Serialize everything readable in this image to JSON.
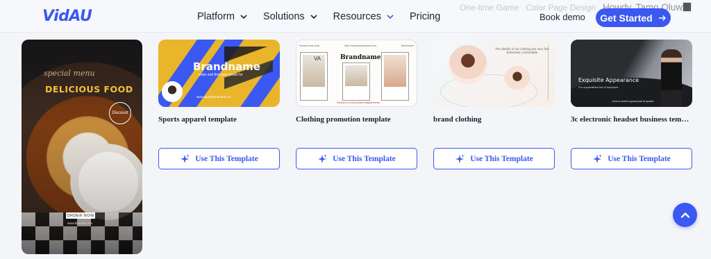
{
  "header": {
    "logo": "VidAU",
    "nav": [
      {
        "label": "Platform",
        "has_dropdown": true
      },
      {
        "label": "Solutions",
        "has_dropdown": true
      },
      {
        "label": "Resources",
        "has_dropdown": true,
        "active": true
      },
      {
        "label": "Pricing",
        "has_dropdown": false
      }
    ],
    "ghost_text": [
      "One-time Game",
      "Color Page Design"
    ],
    "ghost_user": "Howdy, Tamo Oluwa",
    "book_demo": "Book demo",
    "get_started": "Get Started"
  },
  "hero_template": {
    "script_text": "special menu",
    "title": "DELICIOUS FOOD",
    "ring_text": "Discount",
    "order_button": "ORDER NOW",
    "url": "www.fimediia.com"
  },
  "templates": [
    {
      "name": "Sports apparel template",
      "thumb": {
        "brand": "Brandname",
        "sub": "enter and find your goods for",
        "tiny": "www.sportbrandname.co"
      },
      "button": "Use This Template"
    },
    {
      "name": "Clothing promotion template",
      "thumb": {
        "brand": "Brandname",
        "header_left": "Fashion work shop",
        "header_mid": "https://www.brandaname.com",
        "header_right": "Brandname",
        "va": "VA",
        "footer": "Fashion in a world where elegant meets"
      },
      "button": "Use This Template"
    },
    {
      "name": "brand clothing",
      "thumb": {
        "caption": "The details of our clothing are very fine Extremely comfortable"
      },
      "button": "Use This Template"
    },
    {
      "name": "3c electronic headset business templ...",
      "thumb": {
        "title": "Exquisite Appearance",
        "sub": "For unparalleled full of earphone",
        "line": "how to meet a good pair of sports"
      },
      "button": "Use This Template"
    }
  ],
  "colors": {
    "accent": "#3b59f2",
    "background": "#f4f5f9",
    "food_title": "#f2c23a",
    "sports_yellow": "#e9b52a"
  },
  "icons": {
    "dropdown": "chevron-down-icon",
    "arrow": "arrow-right-icon",
    "sparkle": "sparkle-icon",
    "scroll_top": "chevron-up-icon"
  }
}
